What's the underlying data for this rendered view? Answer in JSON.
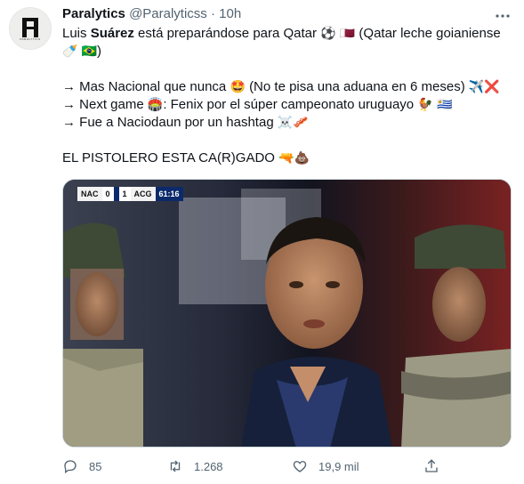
{
  "tweet": {
    "author": {
      "name": "Paralytics",
      "handle": "@Paralyticss",
      "separator": "·",
      "time": "10h",
      "avatar_mark": "PARALYTICS"
    },
    "text": {
      "line1_pre": "Luis ",
      "line1_bold": "Suárez",
      "line1_post": " está preparándose para Qatar",
      "line1_tail": "(Qatar leche goianiense",
      "line2_tail": ")",
      "bullet1": "→ Mas Nacional que nunca",
      "bullet1_tail": "(No te pisa una aduana en 6 meses)",
      "bullet2_pre": "→ Next game",
      "bullet2_post": ": Fenix por el súper campeonato uruguayo",
      "bullet3": "→ Fue a Naciodaun por un hashtag",
      "closing": "EL PISTOLERO ESTA CA(R)GADO"
    },
    "emojis": {
      "soccer": "⚽",
      "qatar_flag": "🇶🇦",
      "baby_bottle": "🍼",
      "brazil_flag": "🇧🇷",
      "star_struck": "🤩",
      "airplane": "✈️",
      "cross_mark": "❌",
      "stadium": "🏟️",
      "rooster": "🐓",
      "uruguay_flag": "🇺🇾",
      "skull_bones": "☠️",
      "sausage": "🥓",
      "water_pistol": "🔫",
      "poop": "💩"
    },
    "media": {
      "scorebug": {
        "home": "NAC",
        "home_score": "0",
        "away_score": "1",
        "away": "ACG",
        "clock": "61:16"
      }
    },
    "actions": {
      "replies": "85",
      "retweets": "1.268",
      "likes": "19,9 mil",
      "share": ""
    }
  },
  "colors": {
    "text": "#0f1419",
    "secondary": "#536471",
    "border": "#cfd9de"
  }
}
